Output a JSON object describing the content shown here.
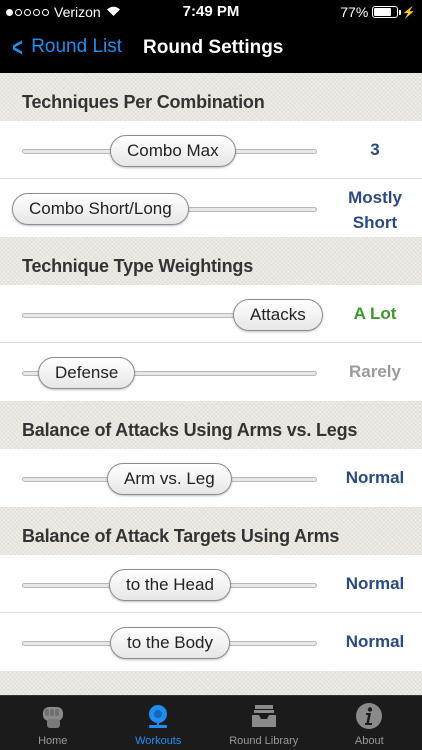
{
  "status": {
    "carrier": "Verizon",
    "time": "7:49 PM",
    "battery": "77%",
    "battery_level": 0.77
  },
  "nav": {
    "back_label": "Round List",
    "title": "Round Settings"
  },
  "colors": {
    "accent": "#1f8ef1",
    "value_blue": "#2a4a80",
    "value_green": "#3a9a2a",
    "value_gray": "#9a9a9a"
  },
  "sections": [
    {
      "title": "Techniques Per Combination",
      "rows": [
        {
          "thumb": "Combo Max",
          "value": "3",
          "value_lines": 1,
          "position": 0.52,
          "color": "#2a4a80"
        },
        {
          "thumb": "Combo Short/Long",
          "value_line1": "Mostly",
          "value_line2": "Short",
          "value_lines": 2,
          "position": 0.0,
          "color": "#2a4a80"
        }
      ]
    },
    {
      "title": "Technique Type Weightings",
      "rows": [
        {
          "thumb": "Attacks",
          "value": "A Lot",
          "value_lines": 1,
          "position": 0.98,
          "color": "#3a9a2a"
        },
        {
          "thumb": "Defense",
          "value": "Rarely",
          "value_lines": 1,
          "position": 0.12,
          "color": "#9a9a9a"
        }
      ]
    },
    {
      "title": "Balance of Attacks Using Arms vs. Legs",
      "rows": [
        {
          "thumb": "Arm vs. Leg",
          "value": "Normal",
          "value_lines": 1,
          "position": 0.5,
          "color": "#2a4a80"
        }
      ]
    },
    {
      "title": "Balance of Attack Targets Using Arms",
      "rows": [
        {
          "thumb": "to the Head",
          "value": "Normal",
          "value_lines": 1,
          "position": 0.5,
          "color": "#2a4a80"
        },
        {
          "thumb": "to the Body",
          "value": "Normal",
          "value_lines": 1,
          "position": 0.5,
          "color": "#2a4a80"
        }
      ]
    }
  ],
  "tabs": [
    {
      "label": "Home",
      "icon": "fist-icon",
      "active": false
    },
    {
      "label": "Workouts",
      "icon": "bell-icon",
      "active": true
    },
    {
      "label": "Round Library",
      "icon": "inbox-tray-icon",
      "active": false
    },
    {
      "label": "About",
      "icon": "info-icon",
      "active": false
    }
  ]
}
